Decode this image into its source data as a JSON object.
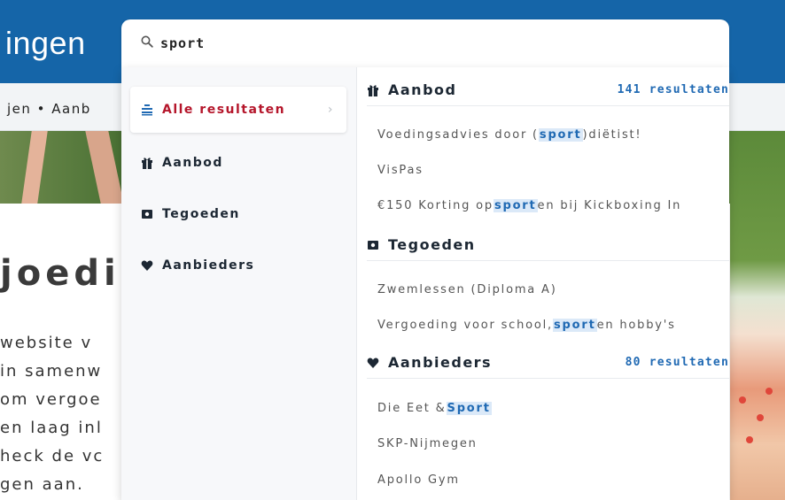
{
  "site": {
    "title": "ingen",
    "breadcrumb": "jen  •  Aanb",
    "heading": "joedi",
    "text_lines": [
      "website v",
      "in samenw",
      "om vergoe",
      "en laag inl",
      "heck de vc",
      "gen aan."
    ]
  },
  "search": {
    "icon": "search-icon",
    "value": "sport"
  },
  "categories": [
    {
      "label": "Alle resultaten",
      "icon": "list-icon",
      "active": true
    },
    {
      "label": "Aanbod",
      "icon": "gift-icon",
      "active": false
    },
    {
      "label": "Tegoeden",
      "icon": "wallet-icon",
      "active": false
    },
    {
      "label": "Aanbieders",
      "icon": "heart-icon",
      "active": false
    }
  ],
  "sections": {
    "aanbod": {
      "title": "Aanbod",
      "count": "141 resultaten",
      "items": [
        {
          "before": "Voedingsadvies door (",
          "highlight": "sport",
          "after": ")diëtist!"
        },
        {
          "before": "VisPas",
          "highlight": "",
          "after": ""
        },
        {
          "before": "€150 Korting op ",
          "highlight": "sport",
          "after": "en bij Kickboxing In"
        }
      ]
    },
    "tegoeden": {
      "title": "Tegoeden",
      "count": "",
      "items": [
        {
          "before": "Zwemlessen (Diploma A)",
          "highlight": "",
          "after": ""
        },
        {
          "before": "Vergoeding voor school, ",
          "highlight": "sport",
          "after": " en hobby's"
        }
      ]
    },
    "aanbieders": {
      "title": "Aanbieders",
      "count": "80 resultaten",
      "items": [
        {
          "before": "Die Eet & ",
          "highlight": "Sport",
          "after": ""
        },
        {
          "before": "SKP-Nijmegen",
          "highlight": "",
          "after": ""
        },
        {
          "before": "Apollo Gym",
          "highlight": "",
          "after": ""
        }
      ]
    }
  },
  "colors": {
    "brand_blue": "#1565a8",
    "active_red": "#b5162b",
    "link_blue": "#1f69b3",
    "icon_navy": "#1c2733"
  }
}
